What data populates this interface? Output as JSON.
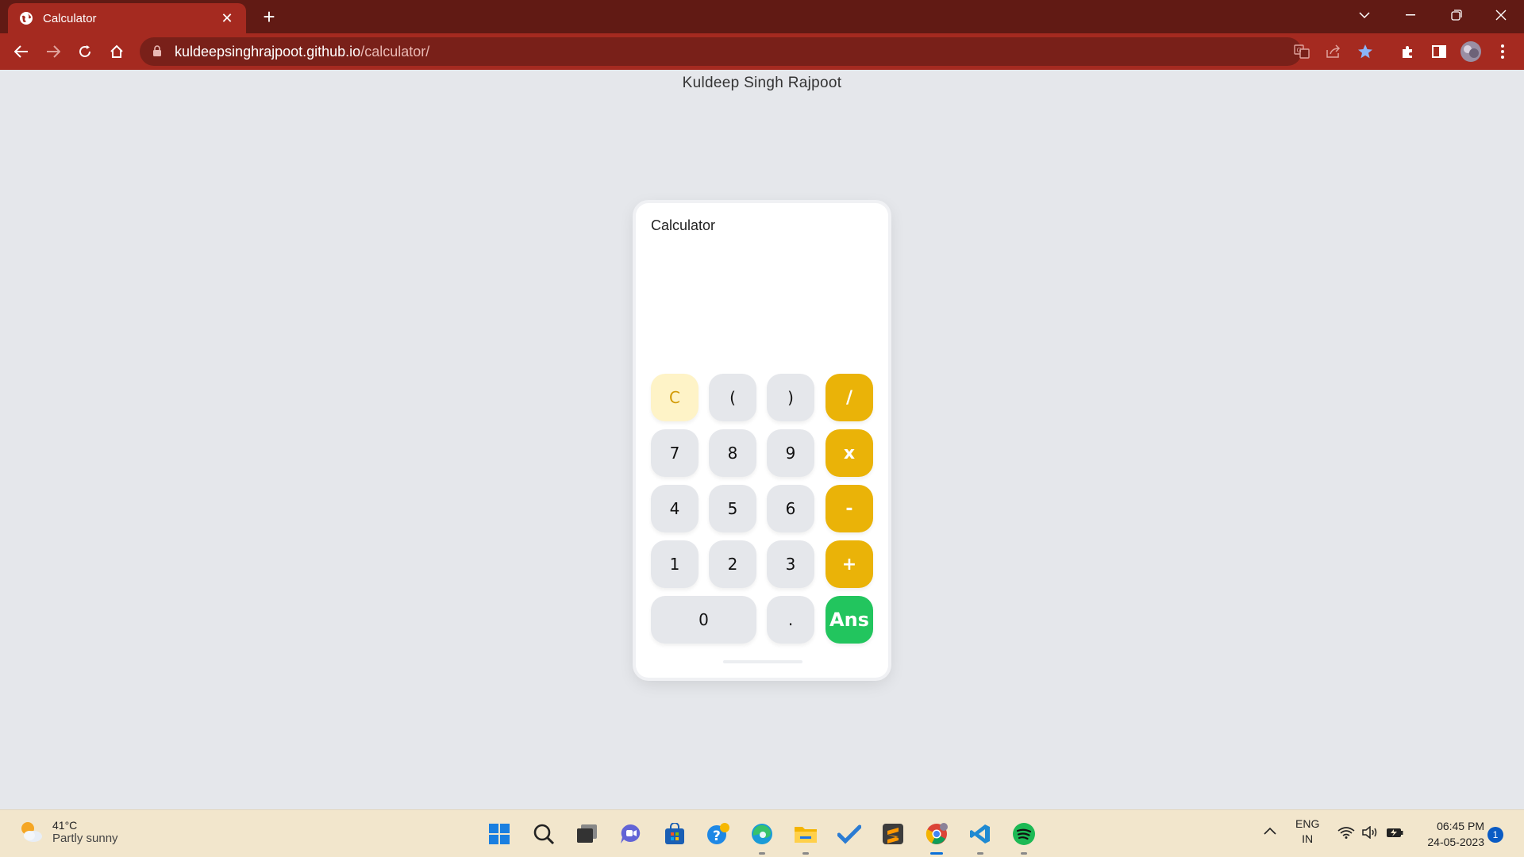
{
  "browser": {
    "tab_title": "Calculator",
    "url_host": "kuldeepsinghrajpoot.github.io",
    "url_path": "/calculator/"
  },
  "page": {
    "author": "Kuldeep Singh Rajpoot"
  },
  "calculator": {
    "title": "Calculator",
    "display": "",
    "keys": {
      "clear": "C",
      "open_paren": "(",
      "close_paren": ")",
      "divide": "/",
      "seven": "7",
      "eight": "8",
      "nine": "9",
      "multiply": "x",
      "four": "4",
      "five": "5",
      "six": "6",
      "subtract": "-",
      "one": "1",
      "two": "2",
      "three": "3",
      "add": "+",
      "zero": "0",
      "decimal": ".",
      "answer": "Ans"
    },
    "colors": {
      "operator": "#eab308",
      "answer": "#22c55e",
      "clear_bg": "#fef3c7"
    }
  },
  "taskbar": {
    "temperature": "41°C",
    "weather_condition": "Partly sunny",
    "language": "ENG",
    "region": "IN",
    "time": "06:45 PM",
    "date": "24-05-2023",
    "notification_count": "1"
  }
}
